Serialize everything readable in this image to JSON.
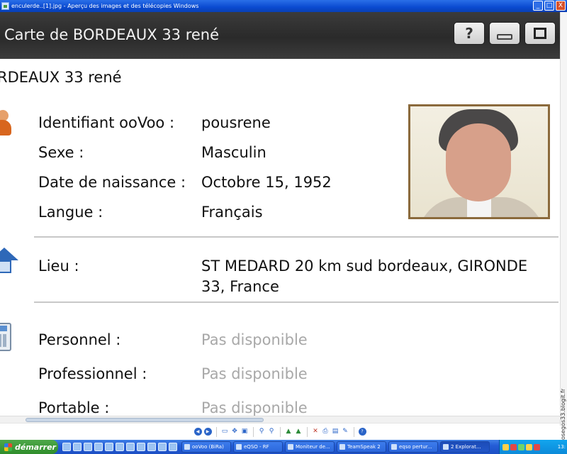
{
  "window": {
    "title": "enculerde..[1].jpg - Aperçu des images et des télécopies Windows",
    "controls": [
      "_",
      "□",
      "X"
    ]
  },
  "profile_window": {
    "title": "Carte de BORDEAUX 33   rené",
    "help_label": "?"
  },
  "profile": {
    "heading": "RDEAUX 33   rené",
    "fields": [
      {
        "label": "Identifiant ooVoo :",
        "value": "pousrene"
      },
      {
        "label": "Sexe :",
        "value": "Masculin"
      },
      {
        "label": "Date de naissance :",
        "value": "Octobre 15, 1952"
      },
      {
        "label": "Langue :",
        "value": "Français"
      }
    ],
    "location": {
      "label": "Lieu :",
      "value_line1": "ST MEDARD    20 km sud bordeaux, GIRONDE",
      "value_line2": "33, France"
    },
    "phones": [
      {
        "label": "Personnel :",
        "value": "Pas disponible"
      },
      {
        "label": "Professionnel :",
        "value": "Pas disponible"
      },
      {
        "label": "Portable :",
        "value": "Pas disponible"
      }
    ]
  },
  "watermark": "egosegos33.blogit.fr",
  "taskbar": {
    "start_label": "démarrer",
    "tasks": [
      "ooVoo (BiRa)",
      "eQSO - RF",
      "Moniteur de...",
      "TeamSpeak 2",
      "eqso pertur...",
      "2 Explorat..."
    ],
    "clock": "13:"
  },
  "colors": {
    "inner_titlebar": "#2e2e2e",
    "photo_border": "#8b6a3c",
    "muted_text": "#a8a8a8",
    "xp_blue": "#245dd7",
    "start_green": "#2f8d2b"
  }
}
